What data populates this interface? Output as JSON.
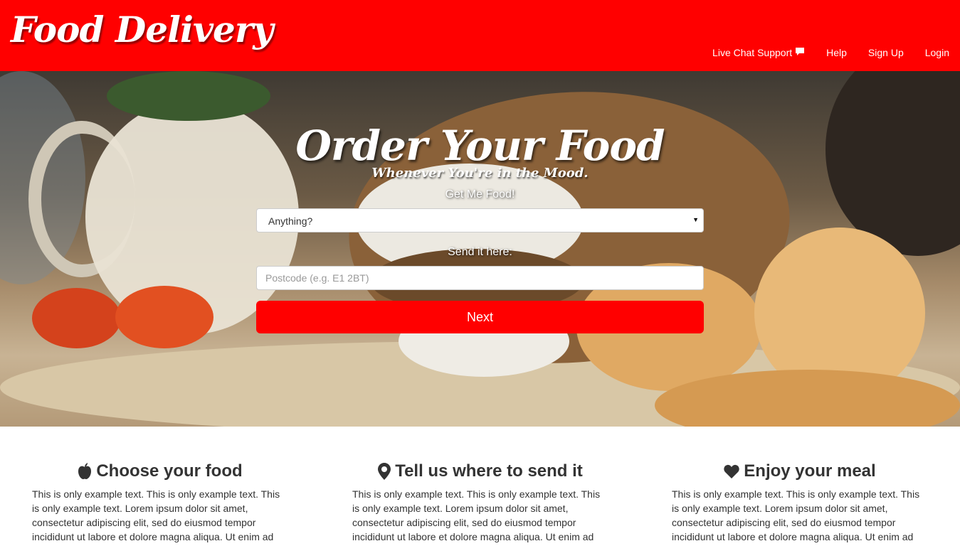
{
  "header": {
    "brand": "Food Delivery",
    "background_color": "#ff0000",
    "nav": [
      {
        "label": "Live Chat Support",
        "icon": "chat-bubble-icon"
      },
      {
        "label": "Help"
      },
      {
        "label": "Sign Up"
      },
      {
        "label": "Login"
      }
    ]
  },
  "hero": {
    "title": "Order Your Food",
    "subtitle": "Whenever You're in the Mood.",
    "food_label": "Get Me Food!",
    "food_select_value": "Anything?",
    "send_label": "Send it here:",
    "postcode_placeholder": "Postcode (e.g. E1 2BT)",
    "next_button": "Next",
    "button_color": "#ff0000"
  },
  "features": [
    {
      "icon": "apple-icon",
      "title": "Choose your food",
      "text": "This is only example text. This is only example text. This is only example text. Lorem ipsum dolor sit amet, consectetur adipiscing elit, sed do eiusmod tempor incididunt ut labore et dolore magna aliqua. Ut enim ad"
    },
    {
      "icon": "map-marker-icon",
      "title": "Tell us where to send it",
      "text": "This is only example text. This is only example text. This is only example text. Lorem ipsum dolor sit amet, consectetur adipiscing elit, sed do eiusmod tempor incididunt ut labore et dolore magna aliqua. Ut enim ad"
    },
    {
      "icon": "heart-icon",
      "title": "Enjoy your meal",
      "text": "This is only example text. This is only example text. This is only example text. Lorem ipsum dolor sit amet, consectetur adipiscing elit, sed do eiusmod tempor incididunt ut labore et dolore magna aliqua. Ut enim ad"
    }
  ]
}
